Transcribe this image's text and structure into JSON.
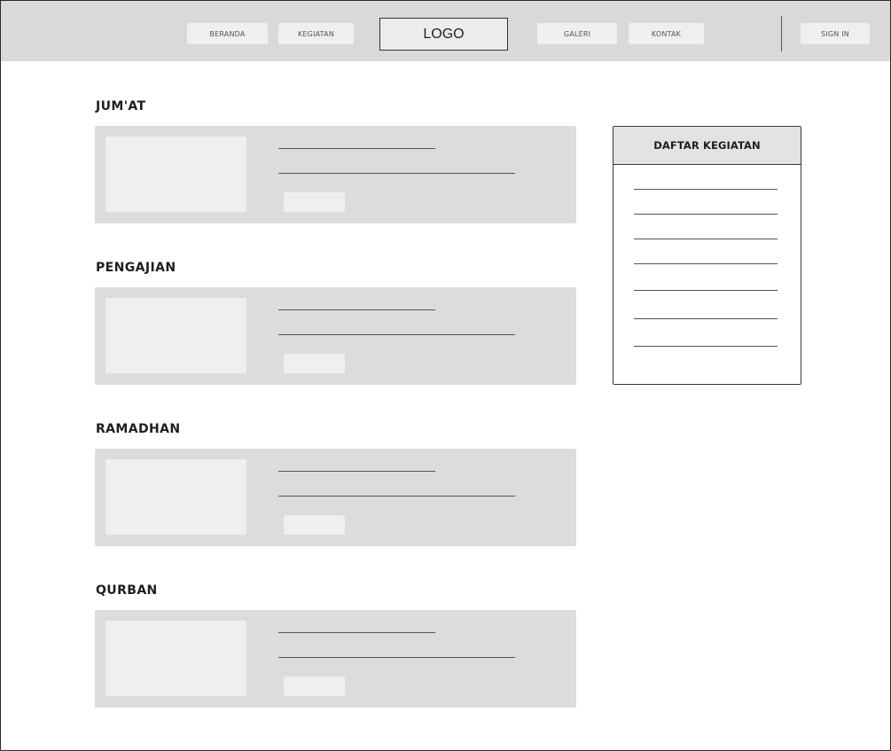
{
  "navbar": {
    "items": [
      {
        "label": "BERANDA"
      },
      {
        "label": "KEGIATAN"
      },
      {
        "label": "GALERI"
      },
      {
        "label": "KONTAK"
      }
    ],
    "logo": "LOGO",
    "signin": "SIGN IN"
  },
  "sections": [
    {
      "title": "JUM'AT"
    },
    {
      "title": "PENGAJIAN"
    },
    {
      "title": "RAMADHAN"
    },
    {
      "title": "QURBAN"
    }
  ],
  "sidebar": {
    "title": "DAFTAR KEGIATAN"
  }
}
